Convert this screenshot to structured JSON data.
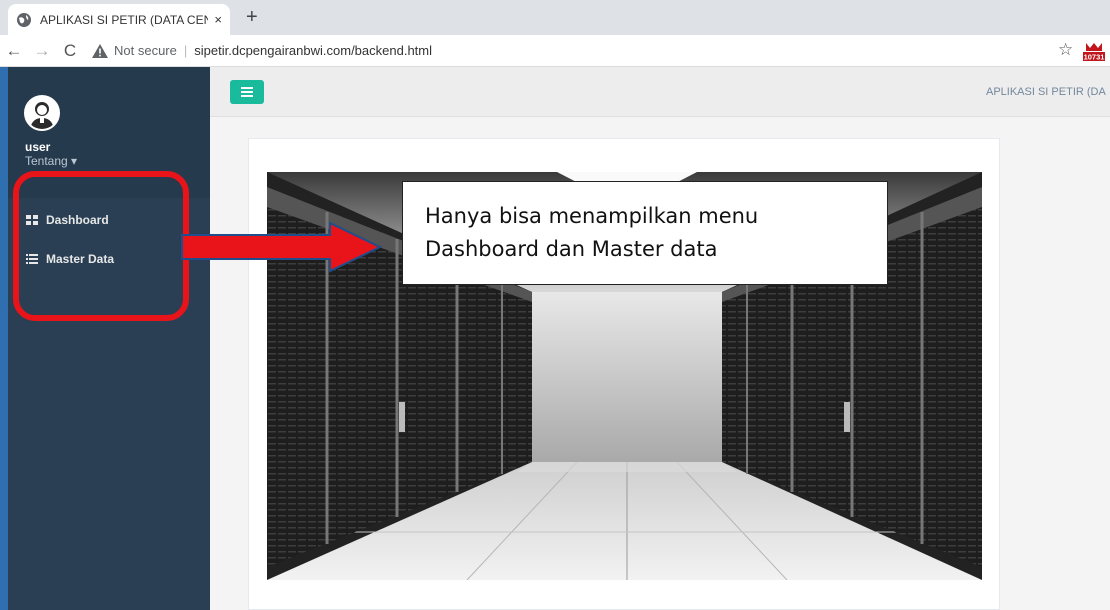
{
  "browser": {
    "tab_title": "APLIKASI SI PETIR (DATA CENTER",
    "tab_close": "×",
    "new_tab": "+",
    "back": "←",
    "forward": "→",
    "reload": "C",
    "security_label": "Not secure",
    "separator": "|",
    "url": "sipetir.dcpengairanbwi.com/backend.html",
    "star": "☆",
    "extension_badge": "10731"
  },
  "sidebar": {
    "username": "user",
    "profile_menu": "Tentang ▾",
    "items": [
      {
        "label": "Dashboard",
        "icon": "th-large-icon"
      },
      {
        "label": "Master Data",
        "icon": "list-icon"
      }
    ]
  },
  "topnav": {
    "app_title": "APLIKASI SI PETIR (DA"
  },
  "annotation": {
    "line1": "Hanya bisa menampilkan menu",
    "line2": "Dashboard dan Master data",
    "highlight_color": "#e8141a"
  },
  "colors": {
    "sidebar": "#2a3f54",
    "accent": "#1abb9c"
  }
}
